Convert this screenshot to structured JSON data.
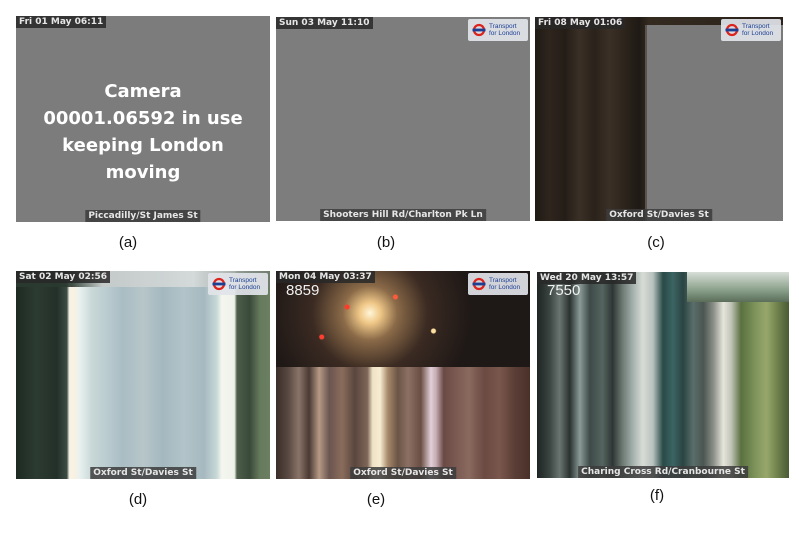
{
  "panels": [
    {
      "caption": "(a)",
      "timestamp": "Fri 01 May 06:11",
      "location": "Piccadilly/St James St",
      "message": "Camera 00001.06592 in use keeping London moving"
    },
    {
      "caption": "(b)",
      "timestamp": "Sun 03 May 11:10",
      "location": "Shooters Hill Rd/Charlton Pk Ln",
      "logo": [
        "Transport",
        "for London"
      ]
    },
    {
      "caption": "(c)",
      "timestamp": "Fri 08 May 01:06",
      "location": "Oxford St/Davies St",
      "logo": [
        "Transport",
        "for London"
      ]
    },
    {
      "caption": "(d)",
      "timestamp": "Sat 02 May 02:56",
      "location": "Oxford St/Davies St",
      "logo": [
        "Transport",
        "for London"
      ]
    },
    {
      "caption": "(e)",
      "timestamp": "Mon 04 May 03:37",
      "location": "Oxford St/Davies St",
      "number": "8859",
      "logo": [
        "Transport",
        "for London"
      ]
    },
    {
      "caption": "(f)",
      "timestamp": "Wed 20 May 13:57",
      "location": "Charing Cross Rd/Cranbourne St",
      "number": "7550"
    }
  ],
  "colors": {
    "no_signal_grey": "#7a7a7a",
    "tfl_blue": "#1c3f94",
    "tfl_red": "#dc241f"
  }
}
